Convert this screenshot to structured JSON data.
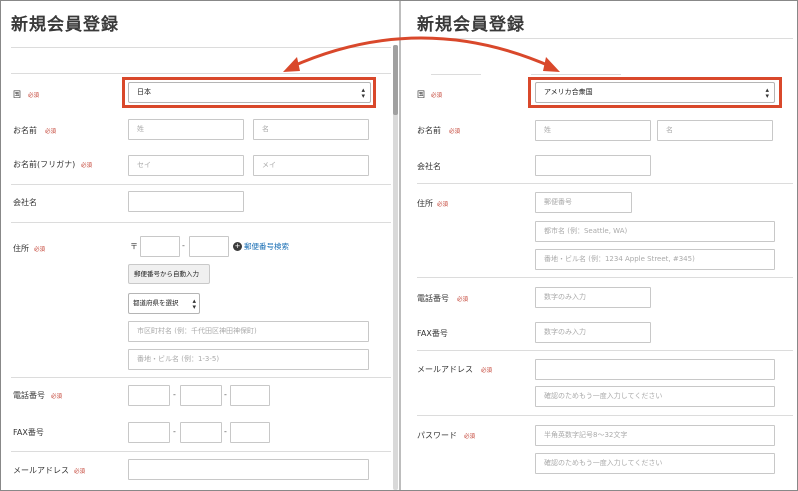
{
  "left": {
    "title": "新規会員登録",
    "country": {
      "label": "国",
      "req": "必須",
      "value": "日本"
    },
    "name": {
      "label": "お名前",
      "req": "必須",
      "last": "姓",
      "first": "名"
    },
    "kana": {
      "label": "お名前(フリガナ)",
      "req": "必須",
      "last": "セイ",
      "first": "メイ"
    },
    "company": {
      "label": "会社名"
    },
    "address": {
      "label": "住所",
      "req": "必須",
      "postal_mark": "〒",
      "dash": "-",
      "search_link": "郵便番号検索",
      "auto_button": "郵便番号から自動入力",
      "pref_select": "都道府県を選択",
      "city_placeholder": "市区町村名 (例：千代田区神田神保町)",
      "street_placeholder": "番地・ビル名 (例：1-3-5)"
    },
    "phone": {
      "label": "電話番号",
      "req": "必須",
      "dash": "-"
    },
    "fax": {
      "label": "FAX番号",
      "dash": "-"
    },
    "email": {
      "label": "メールアドレス",
      "req": "必須"
    }
  },
  "right": {
    "title": "新規会員登録",
    "country": {
      "label": "国",
      "req": "必須",
      "value": "アメリカ合衆国"
    },
    "name": {
      "label": "お名前",
      "req": "必須",
      "last": "姓",
      "first": "名"
    },
    "company": {
      "label": "会社名"
    },
    "address": {
      "label": "住所",
      "req": "必須",
      "postal_placeholder": "郵便番号",
      "city_placeholder": "都市名 (例：Seattle, WA)",
      "street_placeholder": "番地・ビル名 (例：1234 Apple Street, #345)"
    },
    "phone": {
      "label": "電話番号",
      "req": "必須",
      "placeholder": "数字のみ入力"
    },
    "fax": {
      "label": "FAX番号",
      "placeholder": "数字のみ入力"
    },
    "email": {
      "label": "メールアドレス",
      "req": "必須",
      "confirm_placeholder": "確認のためもう一度入力してください"
    },
    "password": {
      "label": "パスワード",
      "req": "必須",
      "placeholder": "半角英数字記号8〜32文字",
      "confirm_placeholder": "確認のためもう一度入力してください"
    }
  },
  "icons": {
    "select_arrow": "select-arrow-icon",
    "plus": "plus-circle-icon"
  },
  "colors": {
    "highlight": "#d9482b",
    "required": "#c0392b",
    "link": "#1a6fb5"
  }
}
